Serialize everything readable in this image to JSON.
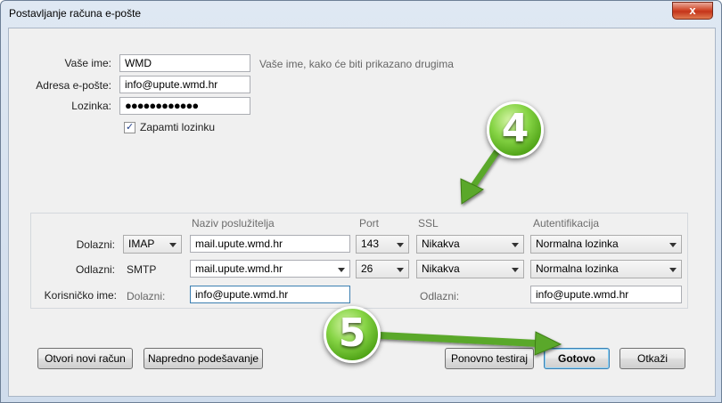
{
  "window": {
    "title": "Postavljanje računa e-pošte",
    "close_label": "x"
  },
  "identity": {
    "name_label": "Vaše ime:",
    "name_value": "WMD",
    "name_hint": "Vaše ime, kako će biti prikazano drugima",
    "email_label": "Adresa e-pošte:",
    "email_value": "info@upute.wmd.hr",
    "password_label": "Lozinka:",
    "password_value": "●●●●●●●●●●●●",
    "remember_label": "Zapamti lozinku",
    "remember_checked": true
  },
  "server": {
    "headers": {
      "hostname": "Naziv poslužitelja",
      "port": "Port",
      "ssl": "SSL",
      "auth": "Autentifikacija"
    },
    "incoming": {
      "label": "Dolazni:",
      "protocol": "IMAP",
      "hostname": "mail.upute.wmd.hr",
      "port": "143",
      "ssl": "Nikakva",
      "auth": "Normalna lozinka"
    },
    "outgoing": {
      "label": "Odlazni:",
      "protocol": "SMTP",
      "hostname": "mail.upute.wmd.hr",
      "port": "26",
      "ssl": "Nikakva",
      "auth": "Normalna lozinka"
    },
    "username": {
      "label": "Korisničko ime:",
      "incoming_label": "Dolazni:",
      "incoming_value": "info@upute.wmd.hr",
      "outgoing_label": "Odlazni:",
      "outgoing_value": "info@upute.wmd.hr"
    }
  },
  "buttons": {
    "new_account": "Otvori novi račun",
    "advanced": "Napredno podešavanje",
    "retest": "Ponovno testiraj",
    "done": "Gotovo",
    "cancel": "Otkaži"
  },
  "annotations": {
    "step4": "4",
    "step5": "5"
  },
  "colors": {
    "badge_green": "#5cb81f",
    "arrow_green": "#5aa82a"
  }
}
